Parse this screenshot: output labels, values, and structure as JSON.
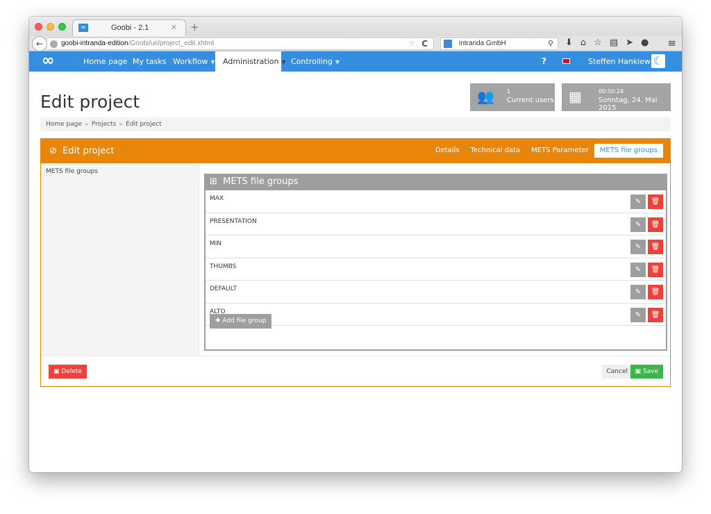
{
  "browser": {
    "tab_title": "Goobi - 2.1",
    "tab_favicon": "∞",
    "url_host": "goobi-intranda-edition",
    "url_path": "/Goobi/uii/project_edit.xhtml",
    "search_engine": "intranda GmbH",
    "toolbar_icons": [
      "download-icon",
      "home-icon",
      "bookmark-star-icon",
      "reading-list-icon",
      "send-icon",
      "chat-icon"
    ]
  },
  "nav": {
    "logo": "∞",
    "items": [
      {
        "label": "Home page",
        "dropdown": false
      },
      {
        "label": "My tasks",
        "dropdown": false
      },
      {
        "label": "Workflow",
        "dropdown": true
      },
      {
        "label": "Administration",
        "dropdown": true,
        "active": true
      },
      {
        "label": "Controlling",
        "dropdown": true
      }
    ],
    "help": "?",
    "language": "en-GB",
    "user_name": "Steffen Hankiewicz"
  },
  "page": {
    "title": "Edit project",
    "breadcrumb": [
      "Home page",
      "Projects",
      "Edit project"
    ]
  },
  "widgets": {
    "users_count": "1",
    "users_label": "Current users",
    "time": "00:50:24",
    "date": "Sonntag, 24. Mai 2015"
  },
  "box": {
    "title": "Edit project",
    "tabs": [
      {
        "label": "Details",
        "active": false
      },
      {
        "label": "Technical data",
        "active": false
      },
      {
        "label": "METS Parameter",
        "active": false
      },
      {
        "label": "METS file groups",
        "active": true
      }
    ],
    "left_label": "METS file groups",
    "table_title": "METS file groups",
    "file_groups": [
      "MAX",
      "PRESENTATION",
      "MIN",
      "THUMBS",
      "DEFAULT",
      "ALTO"
    ],
    "add_label": "Add file group",
    "delete_label": "Delete",
    "cancel_label": "Cancel",
    "save_label": "Save"
  },
  "colors": {
    "primary": "#368ee0",
    "box_accent": "#e8860c",
    "danger": "#f0403a",
    "success": "#3bb648",
    "neutral": "#9e9e9e"
  }
}
